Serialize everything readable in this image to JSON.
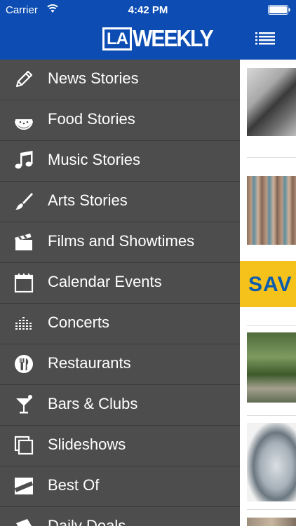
{
  "status_bar": {
    "carrier": "Carrier",
    "time": "4:42 PM"
  },
  "brand": {
    "logo_la": "LA",
    "logo_weekly": "WEEKLY",
    "header_color": "#0d4db3",
    "menu_bg_color": "#4d4d4d"
  },
  "menu": {
    "items": [
      {
        "label": "News Stories",
        "icon": "pencil-icon"
      },
      {
        "label": "Food Stories",
        "icon": "watermelon-icon"
      },
      {
        "label": "Music Stories",
        "icon": "music-note-icon"
      },
      {
        "label": "Arts Stories",
        "icon": "paintbrush-icon"
      },
      {
        "label": "Films and Showtimes",
        "icon": "clapperboard-icon"
      },
      {
        "label": "Calendar Events",
        "icon": "calendar-icon"
      },
      {
        "label": "Concerts",
        "icon": "equalizer-icon"
      },
      {
        "label": "Restaurants",
        "icon": "fork-knife-icon"
      },
      {
        "label": "Bars & Clubs",
        "icon": "cocktail-icon"
      },
      {
        "label": "Slideshows",
        "icon": "slideshow-icon"
      },
      {
        "label": "Best Of",
        "icon": "best-of-icon"
      },
      {
        "label": "Daily Deals",
        "icon": "deals-icon"
      }
    ]
  },
  "content_preview": {
    "ad_text": "SAV",
    "ad_bg_color": "#f5c21b",
    "ad_text_color": "#0b5cad"
  }
}
